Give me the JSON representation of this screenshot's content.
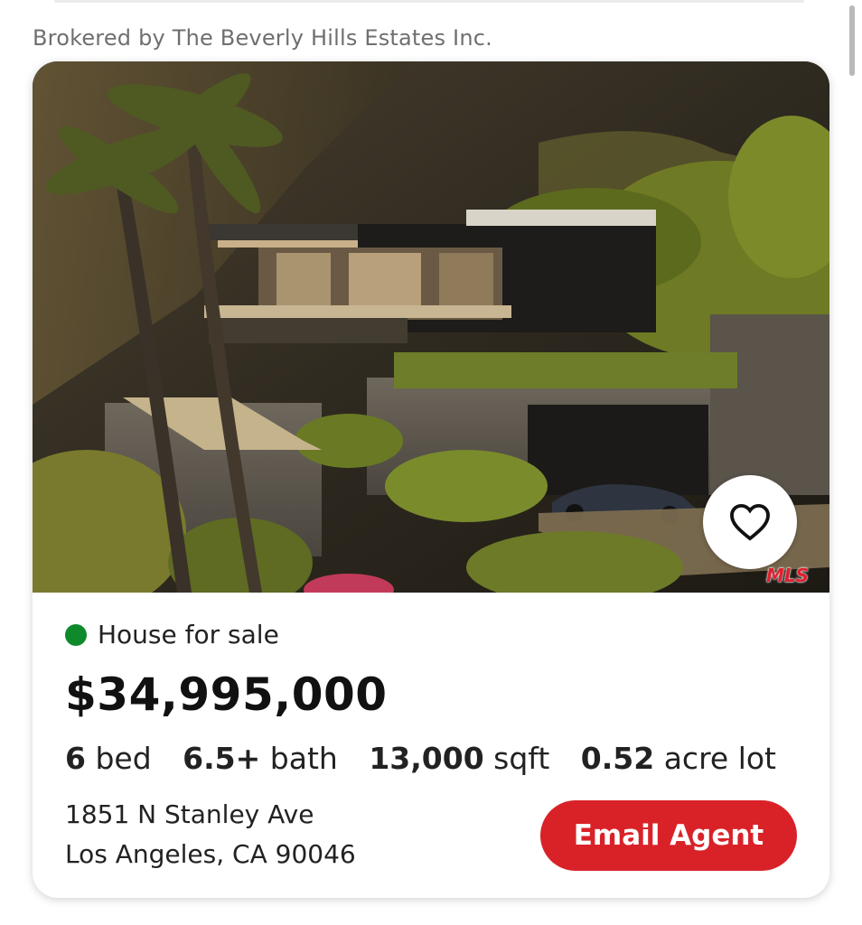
{
  "broker_line": "Brokered by The Beverly Hills Estates Inc.",
  "listing": {
    "status": "House for sale",
    "status_color": "#0e8a2a",
    "price": "$34,995,000",
    "facts": [
      {
        "value": "6",
        "unit": "bed"
      },
      {
        "value": "6.5+",
        "unit": "bath"
      },
      {
        "value": "13,000",
        "unit": "sqft"
      },
      {
        "value": "0.52",
        "unit": "acre lot"
      }
    ],
    "address_line1": "1851 N Stanley Ave",
    "address_line2": "Los Angeles, CA 90046",
    "photo_watermark": "MLS",
    "save_icon": "heart-outline-icon",
    "email_agent_label": "Email Agent",
    "accent_color": "#d92228"
  }
}
